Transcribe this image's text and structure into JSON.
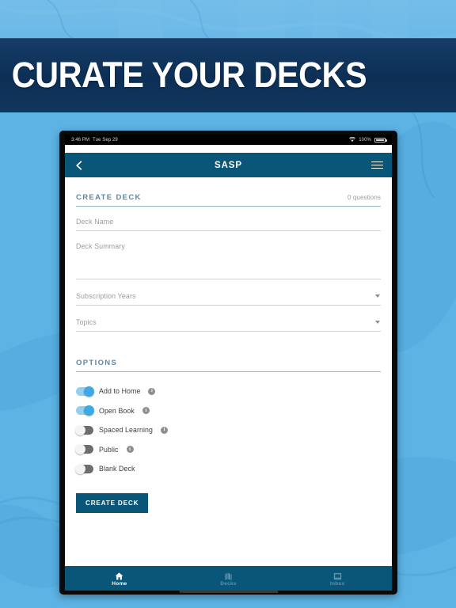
{
  "banner": {
    "headline": "CURATE YOUR DECKS"
  },
  "status_bar": {
    "time": "3:46 PM",
    "date": "Tue Sep 29",
    "wifi_icon": "wifi-icon",
    "battery_percent": "100%",
    "battery_icon": "battery-icon"
  },
  "app_bar": {
    "back_icon": "chevron-left-icon",
    "title": "SASP",
    "menu_icon": "hamburger-menu-icon"
  },
  "create_deck": {
    "section_title": "CREATE DECK",
    "question_count": "0 questions",
    "fields": [
      {
        "name": "deck-name",
        "placeholder": "Deck Name",
        "value": "",
        "type": "text"
      },
      {
        "name": "deck-summary",
        "placeholder": "Deck Summary",
        "value": "",
        "type": "textarea"
      }
    ],
    "selects": [
      {
        "name": "subscription-years",
        "placeholder": "Subscription Years",
        "value": ""
      },
      {
        "name": "topics",
        "placeholder": "Topics",
        "value": ""
      }
    ]
  },
  "options": {
    "section_title": "OPTIONS",
    "toggles": [
      {
        "label": "Add to Home",
        "state": "on",
        "has_info": true
      },
      {
        "label": "Open Book",
        "state": "on",
        "has_info": true
      },
      {
        "label": "Spaced Learning",
        "state": "off",
        "has_info": true
      },
      {
        "label": "Public",
        "state": "off",
        "has_info": true
      },
      {
        "label": "Blank Deck",
        "state": "off",
        "has_info": false
      }
    ],
    "info_icon_glyph": "i"
  },
  "submit": {
    "label": "CREATE DECK"
  },
  "tab_bar": {
    "tabs": [
      {
        "label": "Home",
        "icon": "home-icon",
        "active": true
      },
      {
        "label": "Decks",
        "icon": "cards-icon",
        "active": false
      },
      {
        "label": "Inbox",
        "icon": "inbox-icon",
        "active": false
      }
    ]
  },
  "colors": {
    "banner_navy": "#0d2f55",
    "app_header": "#0a5679",
    "page_background": "#5cb3e4",
    "section_heading": "#5d87a8",
    "toggle_on_track": "#93cfee",
    "toggle_on_knob": "#3ea8e5",
    "toggle_off_track": "#6d6d6d",
    "button": "#0a5679"
  }
}
